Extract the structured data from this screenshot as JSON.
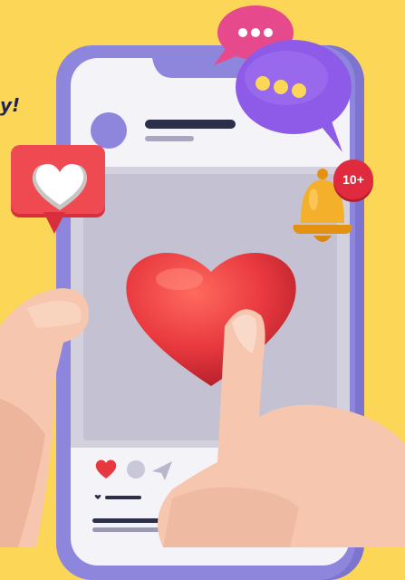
{
  "tagline": "y!",
  "notification": {
    "badge": "10+"
  },
  "colors": {
    "background": "#FCD757",
    "phone": "#8E86DC",
    "heart": "#E8383F",
    "badge": "#E02A3E",
    "bubble_pink": "#E64A8C",
    "bubble_purple": "#8E5BE8",
    "bell": "#F0A020",
    "skin": "#F6C6AE"
  },
  "icons": [
    "heart-icon",
    "comment-icon",
    "send-icon",
    "bell-icon",
    "chat-bubble-icon",
    "like-bubble-icon"
  ]
}
